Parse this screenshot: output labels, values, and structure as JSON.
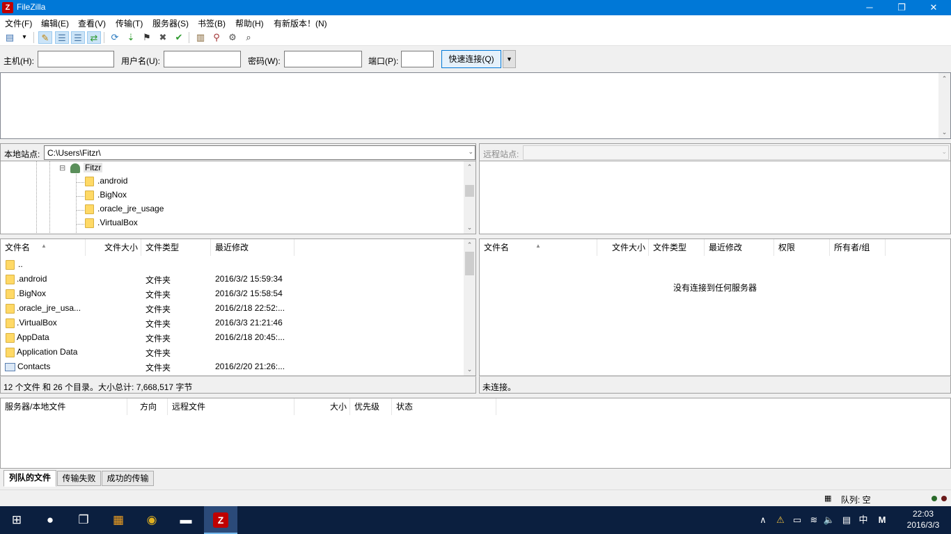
{
  "window": {
    "app_icon": "Z",
    "title": "FileZilla",
    "minimize_icon": "─",
    "restore_icon": "❐",
    "close_icon": "✕"
  },
  "menu": [
    "文件(F)",
    "编辑(E)",
    "查看(V)",
    "传输(T)",
    "服务器(S)",
    "书签(B)",
    "帮助(H)",
    "有新版本！(N)"
  ],
  "toolbar": {
    "icons": [
      "site-manager-icon",
      "dropdown-icon",
      "message-log-icon",
      "local-tree-icon",
      "remote-tree-icon",
      "queue-icon",
      "refresh-icon",
      "process-queue-icon",
      "cancel-icon",
      "disconnect-icon",
      "reconnect-icon",
      "filter-icon",
      "compare-icon",
      "sync-browse-icon",
      "search-icon"
    ],
    "glyphs": [
      "▤",
      "▾",
      "✎",
      "☰",
      "☰",
      "⇄",
      "⟳",
      "⇣",
      "⚑",
      "✖",
      "✔",
      "▥",
      "⚲",
      "⚙",
      "⌕"
    ]
  },
  "quickconnect": {
    "host_label": "主机(H):",
    "host_value": "",
    "user_label": "用户名(U):",
    "user_value": "",
    "pass_label": "密码(W):",
    "pass_value": "",
    "port_label": "端口(P):",
    "port_value": "",
    "connect_label": "快速连接(Q)",
    "dropdown_glyph": "▼"
  },
  "local_site": {
    "label": "本地站点:",
    "path": "C:\\Users\\Fitzr\\"
  },
  "remote_site": {
    "label": "远程站点:",
    "path": ""
  },
  "local_tree": {
    "root": "Fitzr",
    "expand_glyph": "⊟",
    "children": [
      ".android",
      ".BigNox",
      ".oracle_jre_usage",
      ".VirtualBox"
    ]
  },
  "local_files": {
    "columns": [
      "文件名",
      "文件大小",
      "文件类型",
      "最近修改"
    ],
    "rows": [
      {
        "name": "..",
        "type": "",
        "modified": "",
        "icon": "folder"
      },
      {
        "name": ".android",
        "type": "文件夹",
        "modified": "2016/3/2 15:59:34",
        "icon": "folder"
      },
      {
        "name": ".BigNox",
        "type": "文件夹",
        "modified": "2016/3/2 15:58:54",
        "icon": "folder"
      },
      {
        "name": ".oracle_jre_usa...",
        "type": "文件夹",
        "modified": "2016/2/18 22:52:...",
        "icon": "folder"
      },
      {
        "name": ".VirtualBox",
        "type": "文件夹",
        "modified": "2016/3/3 21:21:46",
        "icon": "folder"
      },
      {
        "name": "AppData",
        "type": "文件夹",
        "modified": "2016/2/18 20:45:...",
        "icon": "folder"
      },
      {
        "name": "Application Data",
        "type": "文件夹",
        "modified": "",
        "icon": "folder"
      },
      {
        "name": "Contacts",
        "type": "文件夹",
        "modified": "2016/2/20 21:26:...",
        "icon": "contact"
      }
    ],
    "status": "12 个文件 和 26 个目录。大小总计: 7,668,517 字节"
  },
  "remote_files": {
    "columns": [
      "文件名",
      "文件大小",
      "文件类型",
      "最近修改",
      "权限",
      "所有者/组"
    ],
    "empty_message": "没有连接到任何服务器",
    "status": "未连接。"
  },
  "queue": {
    "columns": [
      "服务器/本地文件",
      "方向",
      "远程文件",
      "大小",
      "优先级",
      "状态"
    ],
    "tabs": [
      "列队的文件",
      "传输失败",
      "成功的传输"
    ],
    "active_tab": 0
  },
  "app_status": {
    "queue_text": "队列: 空",
    "queue_icon_glyph": "▦"
  },
  "taskbar": {
    "start_glyph": "⊞",
    "apps": [
      {
        "name": "cortana-icon",
        "glyph": "●"
      },
      {
        "name": "task-view-icon",
        "glyph": "❐"
      },
      {
        "name": "store-app-icon",
        "glyph": "▦"
      },
      {
        "name": "chrome-icon",
        "glyph": "◉"
      },
      {
        "name": "terminal-icon",
        "glyph": "▬"
      },
      {
        "name": "filezilla-icon",
        "glyph": "Z"
      }
    ],
    "tray": {
      "chevron": "∧",
      "ime_lang": "中",
      "ime_mode": "M",
      "time": "22:03",
      "date": "2016/3/3",
      "tray_glyphs": [
        "⚠",
        "▭",
        "≋",
        "🔈",
        "▤"
      ]
    }
  },
  "colors": {
    "titlebar": "#0078d7",
    "taskbar": "#0b1f3f",
    "folder": "#ffd966"
  }
}
